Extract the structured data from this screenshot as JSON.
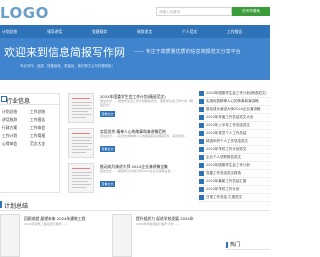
{
  "header": {
    "logo_text": "LOGO",
    "search_placeholder": "请输入关键词",
    "search_button": "去写作搜索"
  },
  "nav": {
    "items": [
      "计划总结",
      "领导讲话",
      "党建政务",
      "致辞发言",
      "个人范文",
      "工作报告"
    ]
  },
  "banner": {
    "title": "欢迎来到信息简报写作网",
    "subtitle": "—— 专注于高质量优质的信息简报范文分享平台",
    "description": "专业写作，品质，快速高效，质量优，我们努力让写作更轻松！"
  },
  "left_panel": {
    "title": "行业信息",
    "categories": [
      [
        "计划总结",
        "工作总结"
      ],
      [
        "讲话致辞",
        "工作报告"
      ],
      [
        "行政方案",
        "工作体会"
      ],
      [
        "工作计划",
        "工作简报"
      ],
      [
        "心得体会",
        "范文大全"
      ]
    ]
  },
  "articles": [
    {
      "title": "2024年团委学生会工作计划(精选范文)",
      "summary": "阅读全文……团委学生会工作计划精选范文，团委学生会工作计划（精选范文）…",
      "button": "查看全文"
    },
    {
      "title": "实用优秀 精神人心的故事和演讲稿范例",
      "summary": "阅读全文……实用优秀精神人心的故事和演讲稿范例，实用优秀…",
      "button": "查看全文"
    },
    {
      "title": "推动成为演讲大师 2024企业演讲稿全集",
      "summary": "阅读全文……推动成为演讲大师2024企业演讲稿全集…",
      "button": "查看全文"
    }
  ],
  "right_list": [
    "2024年团委学生会工作计划(精选范文)",
    "实用优秀精神人心的故事和演讲稿",
    "推动成为演讲大师2024企业演讲稿",
    "2024年年度工作总结范文大全",
    "2024年上半年工作总结范文",
    "2024年党员个人工作总结",
    "精选年终个人工作总结范文",
    "2024年学校工作计划范文",
    "企业个人述职报告范文",
    "2024年团委学生会工作计划",
    "党建工作总结范文精选",
    "2024年最新工作总结汇报",
    "2024年学校工作计划",
    "日常工作总结 汇报范文"
  ],
  "section": {
    "title": "计划总结"
  },
  "bottom_articles": [
    {
      "title": "回顾成就 展望未来 2024年建筑工程",
      "summary": "2024年建筑工程总结与展望……"
    },
    {
      "title": "提升组织力 促进学校发展 2024年",
      "summary": "2024年学校组织力提升计划……"
    }
  ],
  "hot": {
    "title": "热门"
  }
}
